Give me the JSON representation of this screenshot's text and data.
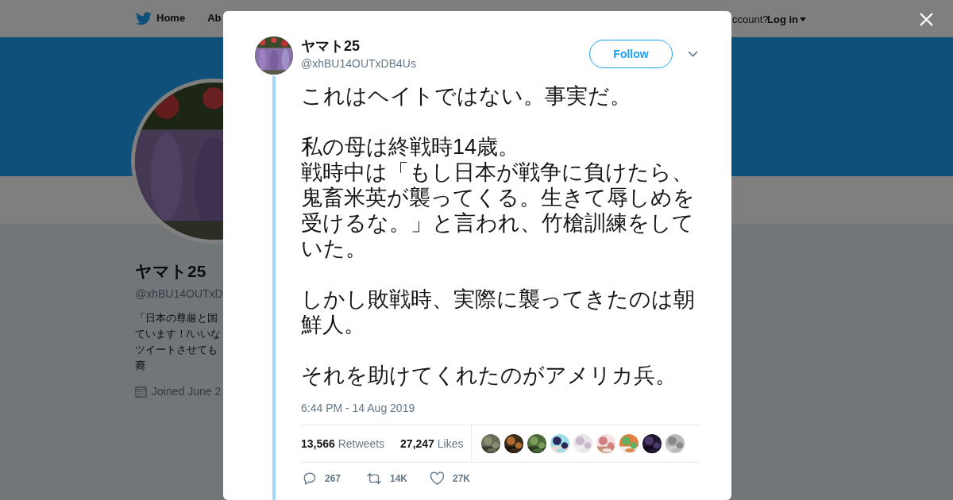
{
  "nav": {
    "home": "Home",
    "about": "Ab",
    "account": "ccount?",
    "login": "Log in"
  },
  "profile": {
    "name": "ヤマト25",
    "handle": "@xhBU14OUTxD",
    "bio": [
      "「日本の尊厳と国",
      "ています！/いいな",
      "ツイートさせても",
      "裔"
    ],
    "joined": "Joined June 2"
  },
  "tweet": {
    "name": "ヤマト25",
    "handle": "@xhBU14OUTxDB4Us",
    "follow": "Follow",
    "body": [
      [
        "これはヘイトではない。事実だ。"
      ],
      [
        "私の母は終戦時14歳。",
        "戦時中は「もし日本が戦争に負けたら、",
        "鬼畜米英が襲ってくる。生きて辱しめを",
        "受けるな。」と言われ、竹槍訓練をして",
        "いた。"
      ],
      [
        "しかし敗戦時、実際に襲ってきたのは朝",
        "鮮人。"
      ],
      [
        "それを助けてくれたのがアメリカ兵。"
      ]
    ],
    "time": "6:44 PM - 14 Aug 2019",
    "retweets": "13,566",
    "retweets_label": "Retweets",
    "likes": "27,247",
    "likes_label": "Likes",
    "likers": [
      {
        "kind": "picture"
      },
      {
        "kind": "picture"
      },
      {
        "kind": "picture"
      },
      {
        "kind": "picture"
      },
      {
        "kind": "picture"
      },
      {
        "kind": "picture"
      },
      {
        "kind": "picture"
      },
      {
        "kind": "picture"
      },
      {
        "kind": "picture"
      }
    ],
    "actions": [
      {
        "kind": "reply",
        "count": "267"
      },
      {
        "kind": "retweet",
        "count": "14K"
      },
      {
        "kind": "like",
        "count": "27K"
      }
    ]
  }
}
